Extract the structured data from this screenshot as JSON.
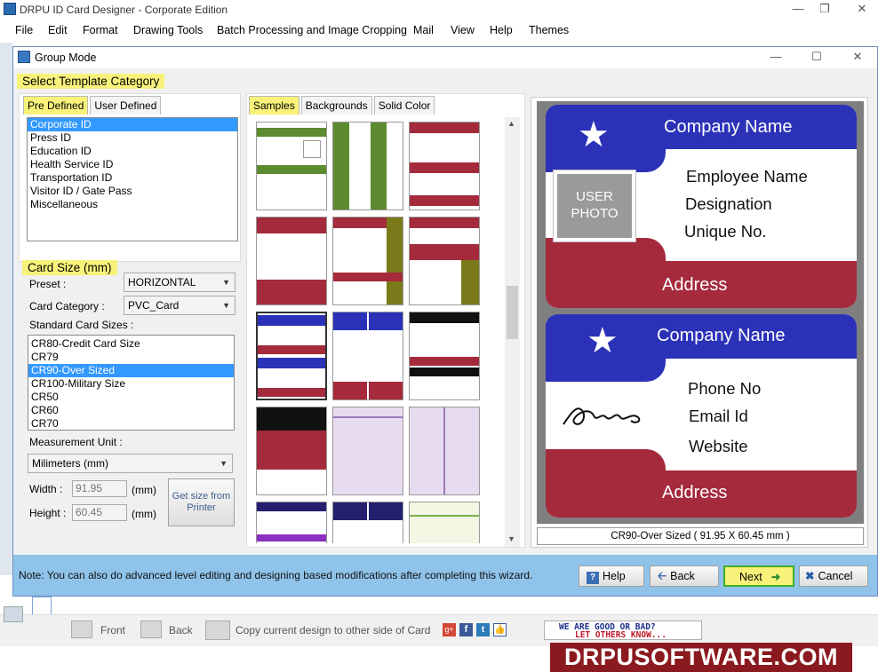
{
  "app": {
    "title": "DRPU ID Card Designer - Corporate Edition"
  },
  "menu": [
    "File",
    "Edit",
    "Format",
    "Drawing Tools",
    "Batch Processing and Image Cropping",
    "Mail",
    "View",
    "Help",
    "Themes"
  ],
  "dialog": {
    "title": "Group Mode"
  },
  "template": {
    "section_title": "Select Template Category",
    "tabs": [
      "Pre Defined",
      "User Defined"
    ],
    "categories": [
      "Corporate ID",
      "Press ID",
      "Education ID",
      "Health Service ID",
      "Transportation ID",
      "Visitor ID / Gate Pass",
      "Miscellaneous"
    ],
    "selected_index": 0
  },
  "card_size": {
    "section_title": "Card Size (mm)",
    "preset_label": "Preset :",
    "preset_value": "HORIZONTAL",
    "category_label": "Card Category :",
    "category_value": "PVC_Card",
    "standard_label": "Standard Card Sizes :",
    "sizes": [
      "CR80-Credit Card Size",
      "CR79",
      "CR90-Over Sized",
      "CR100-Military Size",
      "CR50",
      "CR60",
      "CR70"
    ],
    "selected_size_index": 2,
    "unit_label": "Measurement Unit :",
    "unit_value": "Milimeters (mm)",
    "width_label": "Width :",
    "width_value": "91.95",
    "height_label": "Height :",
    "height_value": "60.45",
    "unit_suffix": "(mm)",
    "printer_button": "Get size from Printer"
  },
  "gallery": {
    "tabs": [
      "Samples",
      "Backgrounds",
      "Solid Color"
    ]
  },
  "preview": {
    "front": {
      "company": "Company Name",
      "photo": "USER PHOTO",
      "lines": [
        "Employee Name",
        "Designation",
        "Unique No."
      ],
      "footer": "Address"
    },
    "back": {
      "company": "Company Name",
      "lines": [
        "Phone No",
        "Email Id",
        "Website"
      ],
      "footer": "Address"
    },
    "size_caption": "CR90-Over Sized ( 91.95 X 60.45 mm )"
  },
  "note": "Note: You can also do advanced level editing and designing based modifications after completing this wizard.",
  "buttons": {
    "help": "Help",
    "back": "Back",
    "next": "Next",
    "cancel": "Cancel"
  },
  "bottom": {
    "front": "Front",
    "back": "Back",
    "copy": "Copy current design to other side of Card",
    "feedback_1": "WE ARE GOOD OR BAD?",
    "feedback_2": "LET OTHERS KNOW..."
  },
  "brand": "DRPUSOFTWARE.COM",
  "colors": {
    "card_blue": "#2b32b8",
    "card_red": "#a42a3c",
    "highlight": "#f8f27a",
    "note_bar": "#8fc3ea",
    "next_border": "#3fae2a"
  }
}
